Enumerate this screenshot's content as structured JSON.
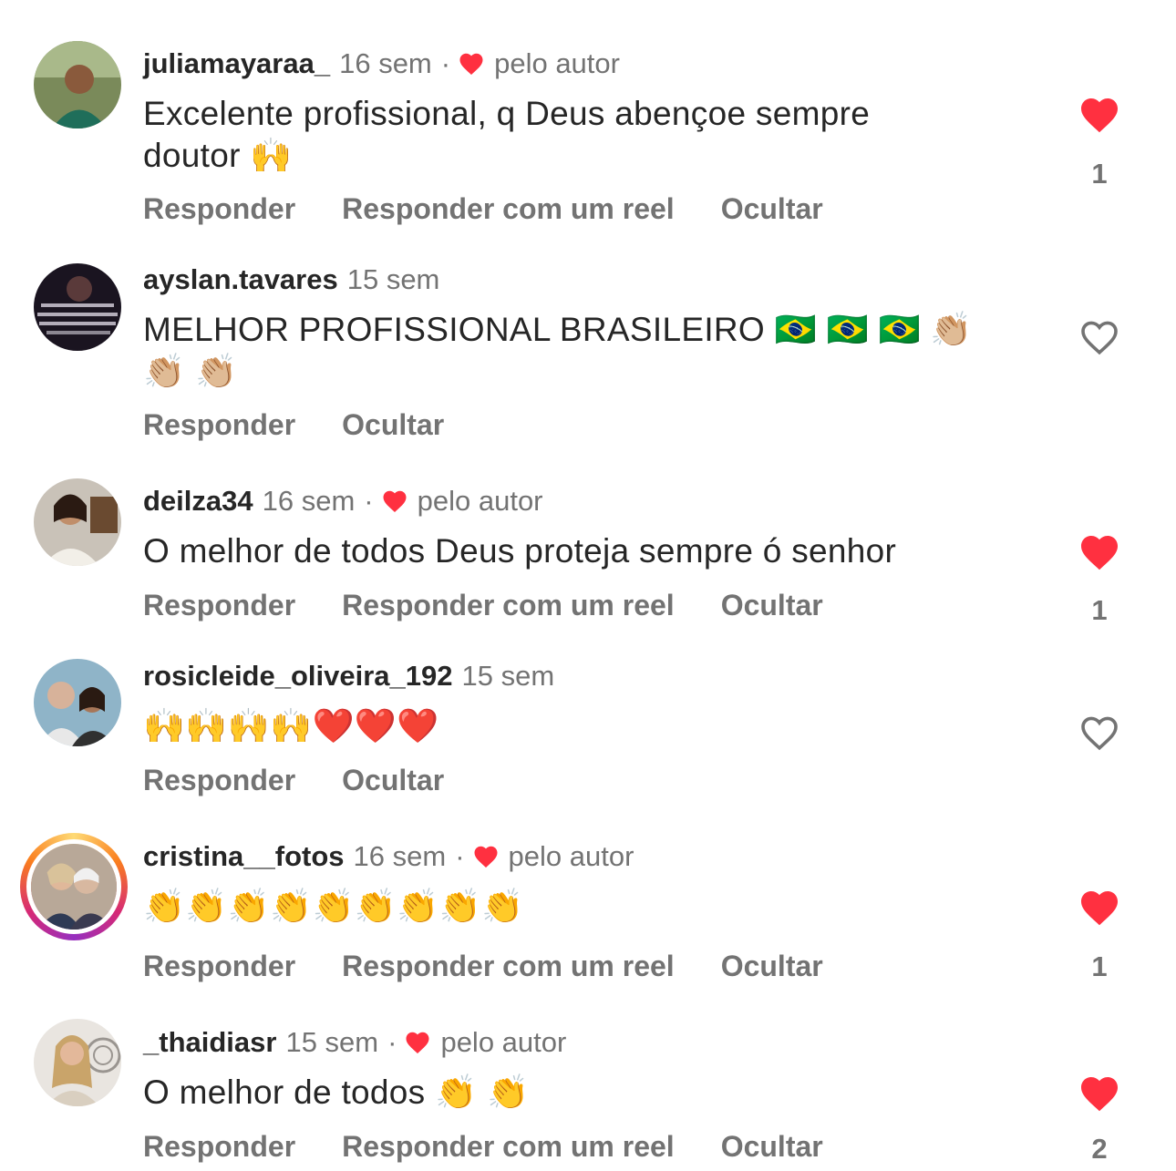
{
  "colors": {
    "like_red": "#ff3040",
    "secondary_text": "#737373",
    "primary_text": "#262626"
  },
  "comments": [
    {
      "username": "juliamayaraa_",
      "time": "16 sem",
      "separator": "·",
      "author_label": "pelo autor",
      "text": "Excelente profissional, q Deus abençoe sempre doutor 🙌",
      "actions": [
        "Responder",
        "Responder com um reel",
        "Ocultar"
      ],
      "liked": true,
      "like_count": "1"
    },
    {
      "username": "ayslan.tavares",
      "time": "15 sem",
      "text": "MELHOR PROFISSIONAL BRASILEIRO 🇧🇷 🇧🇷 🇧🇷 👏🏼 👏🏼 👏🏼",
      "actions": [
        "Responder",
        "Ocultar"
      ],
      "liked": false
    },
    {
      "username": "deilza34",
      "time": "16 sem",
      "separator": "·",
      "author_label": "pelo autor",
      "text": "O melhor de todos Deus proteja sempre ó senhor",
      "actions": [
        "Responder",
        "Responder com um reel",
        "Ocultar"
      ],
      "liked": true,
      "like_count": "1"
    },
    {
      "username": "rosicleide_oliveira_192",
      "time": "15 sem",
      "text": "🙌🙌🙌🙌❤️❤️❤️",
      "actions": [
        "Responder",
        "Ocultar"
      ],
      "liked": false
    },
    {
      "username": "cristina__fotos",
      "time": "16 sem",
      "separator": "·",
      "author_label": "pelo autor",
      "text": "👏👏👏👏👏👏👏👏👏",
      "actions": [
        "Responder",
        "Responder com um reel",
        "Ocultar"
      ],
      "liked": true,
      "like_count": "1"
    },
    {
      "username": "_thaidiasr",
      "time": "15 sem",
      "separator": "·",
      "author_label": "pelo autor",
      "text": "O melhor de todos 👏 👏",
      "actions": [
        "Responder",
        "Responder com um reel",
        "Ocultar"
      ],
      "liked": true,
      "like_count": "2"
    }
  ]
}
